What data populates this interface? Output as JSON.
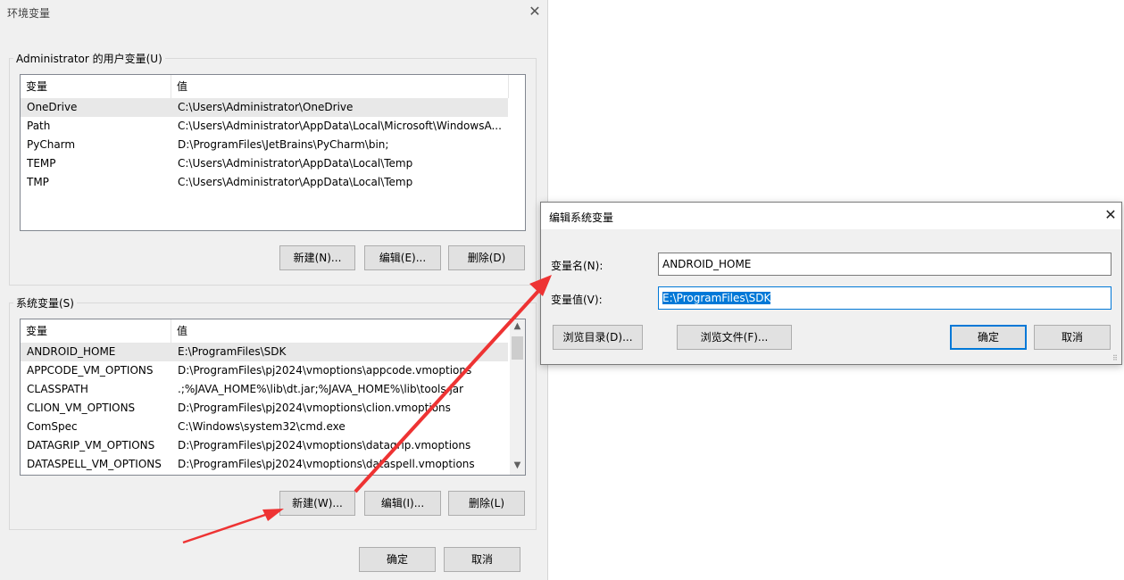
{
  "env_dialog": {
    "title": "环境变量",
    "close_icon": "✕",
    "user_group_title": "Administrator 的用户变量(U)",
    "system_group_title": "系统变量(S)",
    "columns": [
      "变量",
      "值"
    ],
    "user_vars": [
      {
        "name": "OneDrive",
        "value": "C:\\Users\\Administrator\\OneDrive"
      },
      {
        "name": "Path",
        "value": "C:\\Users\\Administrator\\AppData\\Local\\Microsoft\\WindowsA..."
      },
      {
        "name": "PyCharm",
        "value": "D:\\ProgramFiles\\JetBrains\\PyCharm\\bin;"
      },
      {
        "name": "TEMP",
        "value": "C:\\Users\\Administrator\\AppData\\Local\\Temp"
      },
      {
        "name": "TMP",
        "value": "C:\\Users\\Administrator\\AppData\\Local\\Temp"
      }
    ],
    "system_vars": [
      {
        "name": "ANDROID_HOME",
        "value": "E:\\ProgramFiles\\SDK"
      },
      {
        "name": "APPCODE_VM_OPTIONS",
        "value": "D:\\ProgramFiles\\pj2024\\vmoptions\\appcode.vmoptions"
      },
      {
        "name": "CLASSPATH",
        "value": ".;%JAVA_HOME%\\lib\\dt.jar;%JAVA_HOME%\\lib\\tools.jar"
      },
      {
        "name": "CLION_VM_OPTIONS",
        "value": "D:\\ProgramFiles\\pj2024\\vmoptions\\clion.vmoptions"
      },
      {
        "name": "ComSpec",
        "value": "C:\\Windows\\system32\\cmd.exe"
      },
      {
        "name": "DATAGRIP_VM_OPTIONS",
        "value": "D:\\ProgramFiles\\pj2024\\vmoptions\\datagrip.vmoptions"
      },
      {
        "name": "DATASPELL_VM_OPTIONS",
        "value": "D:\\ProgramFiles\\pj2024\\vmoptions\\dataspell.vmoptions"
      }
    ],
    "user_buttons": {
      "new": "新建(N)...",
      "edit": "编辑(E)...",
      "delete": "删除(D)"
    },
    "system_buttons": {
      "new": "新建(W)...",
      "edit": "编辑(I)...",
      "delete": "删除(L)"
    },
    "ok": "确定",
    "cancel": "取消",
    "scroll_up_icon": "▲",
    "scroll_down_icon": "▼"
  },
  "edit_dialog": {
    "title": "编辑系统变量",
    "close_icon": "✕",
    "name_label": "变量名(N):",
    "value_label": "变量值(V):",
    "name_value": "ANDROID_HOME",
    "value_value": "E:\\ProgramFiles\\SDK",
    "browse_dir": "浏览目录(D)...",
    "browse_file": "浏览文件(F)...",
    "ok": "确定",
    "cancel": "取消",
    "grip_icon": "⠿"
  },
  "colors": {
    "annotation_arrow": "#ee3333",
    "focus_blue": "#0078d7"
  }
}
